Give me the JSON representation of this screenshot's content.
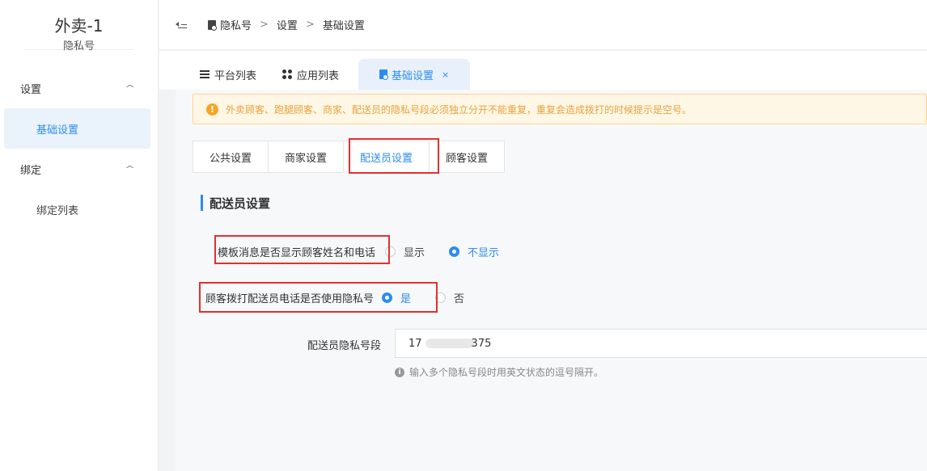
{
  "sidebar": {
    "app_title": "外卖-1",
    "app_subtitle": "隐私号",
    "groups": [
      {
        "label": "设置",
        "items": [
          {
            "label": "基础设置"
          }
        ]
      },
      {
        "label": "绑定",
        "items": [
          {
            "label": "绑定列表"
          }
        ]
      }
    ]
  },
  "breadcrumb": {
    "items": [
      "隐私号",
      "设置",
      "基础设置"
    ],
    "separator": ">"
  },
  "page_tabs": [
    {
      "label": "平台列表",
      "icon": "list-icon"
    },
    {
      "label": "应用列表",
      "icon": "grid-icon"
    },
    {
      "label": "基础设置",
      "icon": "doc-icon",
      "close": "×"
    }
  ],
  "alert": {
    "text": "外卖顾客、跑腿顾客、商家、配送员的隐私号段必须独立分开不能重复，重复会造成拨打的时候提示是空号。"
  },
  "sub_tabs": [
    "公共设置",
    "商家设置",
    "配送员设置",
    "顾客设置"
  ],
  "section_title": "配送员设置",
  "form": {
    "template_msg": {
      "label": "模板消息是否显示顾客姓名和电话",
      "options": [
        "显示",
        "不显示"
      ]
    },
    "use_privacy": {
      "label": "顾客拨打配送员电话是否使用隐私号",
      "options": [
        "是",
        "否"
      ]
    },
    "number_segment": {
      "label": "配送员隐私号段",
      "value_prefix": "17",
      "value_suffix": "375",
      "hint": "输入多个隐私号段时用英文状态的逗号隔开。"
    }
  },
  "colors": {
    "accent": "#2d8cf0",
    "highlight": "#e03131",
    "warning": "#f5a623"
  }
}
